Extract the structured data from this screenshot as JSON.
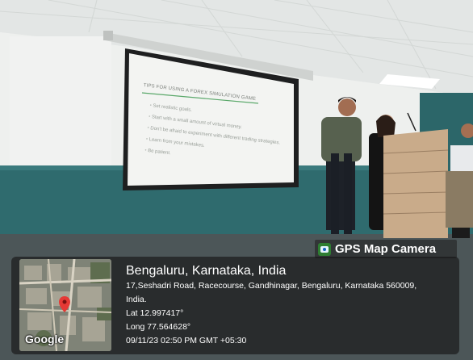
{
  "slide": {
    "title": "TIPS FOR USING A FOREX SIMULATION GAME",
    "bullets": [
      "Set realistic goals.",
      "Start with a small amount of virtual money.",
      "Don't be afraid to experiment with different trading strategies.",
      "Learn from your mistakes.",
      "Be patient."
    ]
  },
  "badge": {
    "label": "GPS Map Camera",
    "icon": "camera-pin-icon"
  },
  "location": {
    "city": "Bengaluru, Karnataka, India",
    "address_line1": "17,Seshadri Road, Racecourse, Gandhinagar, Bengaluru, Karnataka 560009,",
    "address_line2": "India.",
    "lat": "Lat 12.997417°",
    "long": "Long 77.564628°",
    "timestamp": "09/11/23 02:50 PM GMT +05:30"
  },
  "map": {
    "attribution": "Google",
    "pin_color": "#e53935"
  },
  "colors": {
    "wall_teal": "#2f6b6e",
    "ceiling": "#e9ebe9",
    "overlay": "#141414"
  }
}
